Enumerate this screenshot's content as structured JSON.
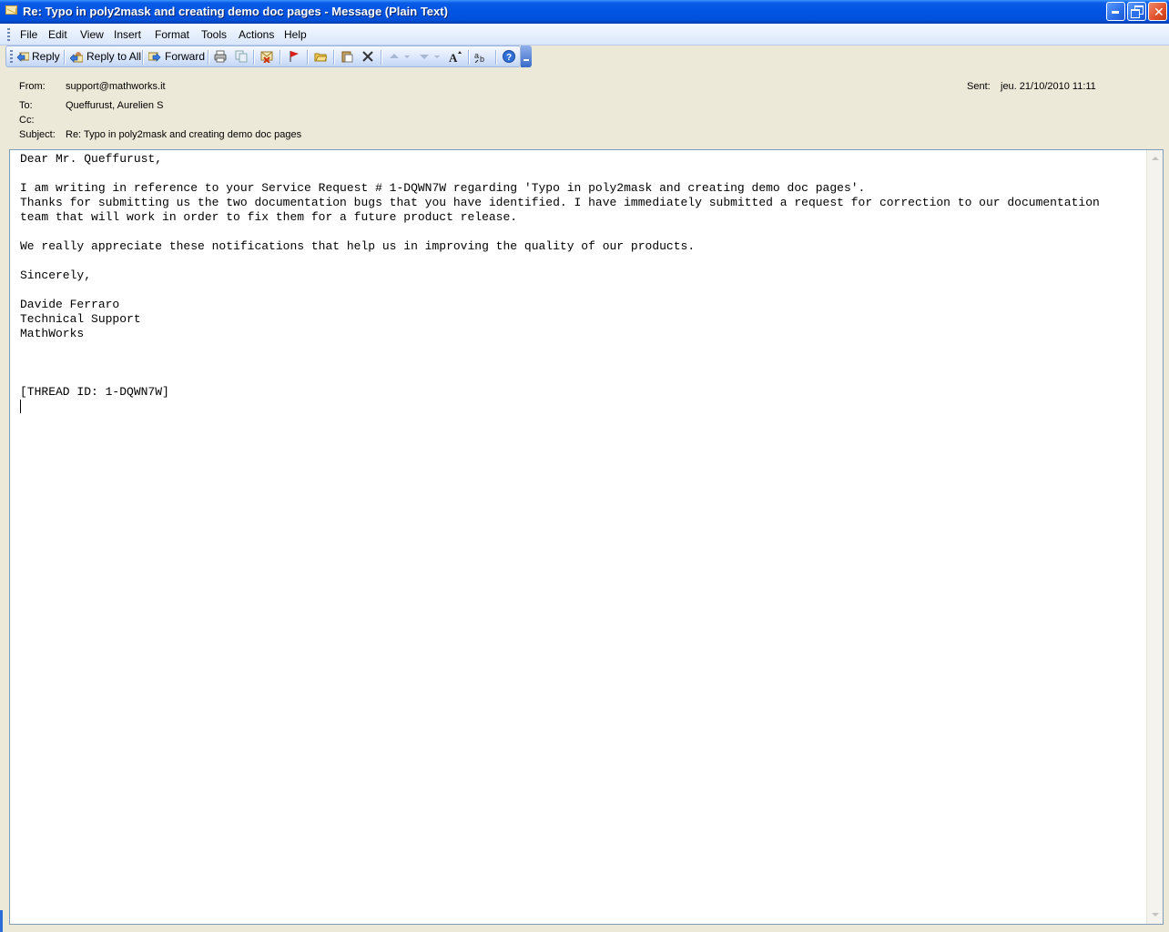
{
  "window": {
    "title": "Re: Typo in poly2mask and creating demo doc pages - Message (Plain Text)"
  },
  "menu": {
    "items": [
      "File",
      "Edit",
      "View",
      "Insert",
      "Format",
      "Tools",
      "Actions",
      "Help"
    ]
  },
  "toolbar": {
    "reply": "Reply",
    "reply_all": "Reply to All",
    "forward": "Forward"
  },
  "header": {
    "from_label": "From:",
    "from_value": "support@mathworks.it",
    "to_label": "To:",
    "to_value": "Queffurust, Aurelien S",
    "cc_label": "Cc:",
    "cc_value": "",
    "subject_label": "Subject:",
    "subject_value": "Re: Typo in poly2mask and creating demo doc pages",
    "sent_label": "Sent:",
    "sent_value": "jeu. 21/10/2010 11:11"
  },
  "message": {
    "body": "Dear Mr. Queffurust,\n\nI am writing in reference to your Service Request # 1-DQWN7W regarding 'Typo in poly2mask and creating demo doc pages'.\nThanks for submitting us the two documentation bugs that you have identified. I have immediately submitted a request for correction to our documentation\nteam that will work in order to fix them for a future product release.\n\nWe really appreciate these notifications that help us in improving the quality of our products.\n\nSincerely,\n\nDavide Ferraro\nTechnical Support\nMathWorks\n\n\n\n[THREAD ID: 1-DQWN7W]"
  },
  "icons": {
    "title": "envelope-icon",
    "reply": "reply-icon",
    "reply_all": "reply-all-icon",
    "forward": "forward-icon",
    "print": "print-icon",
    "copy": "copy-icon",
    "move": "move-to-folder-icon",
    "flag": "flag-icon",
    "open": "open-folder-icon",
    "paste": "paste-icon",
    "delete": "delete-icon",
    "previous": "previous-item-icon",
    "next": "next-item-icon",
    "font_size": "font-size-icon",
    "spelling": "spelling-icon",
    "help": "help-icon"
  }
}
